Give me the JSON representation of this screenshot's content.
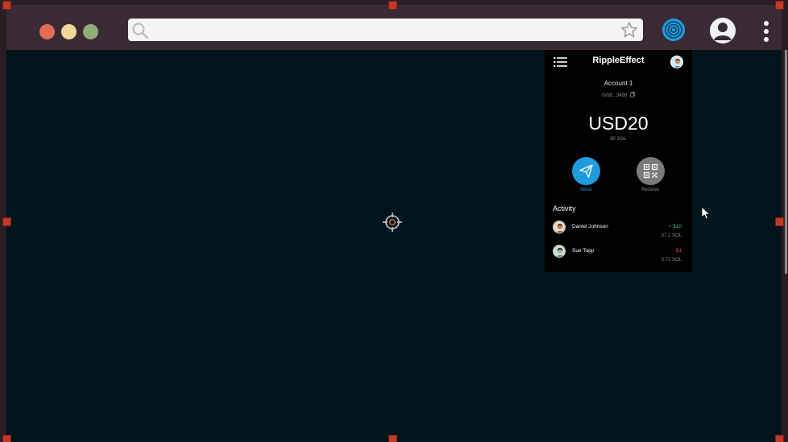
{
  "browser": {
    "search_placeholder": "",
    "search_value": "",
    "icons": [
      "search-icon",
      "star-icon",
      "extension-icon",
      "profile-icon",
      "more-options-icon"
    ]
  },
  "wallet": {
    "title": "RippleEffect",
    "account_name": "Account 1",
    "account_address": "0xfdf...3456",
    "balance": "USD20",
    "balance_sub": "80 SOL",
    "send_label": "Send",
    "receive_label": "Receive",
    "activity_heading": "Activity",
    "activity": [
      {
        "name": "Daniel Johnson",
        "amount": "+ $10",
        "sol": "37.1 SOL",
        "direction": "in"
      },
      {
        "name": "Sue Topp",
        "amount": "- $1",
        "sol": "3.71 SOL",
        "direction": "out"
      }
    ]
  },
  "colors": {
    "page_background": "#00141c",
    "browser_chrome": "#3a2a33",
    "accent": "#1f9bde",
    "positive": "#4cc27a",
    "negative": "#e04a4a"
  }
}
